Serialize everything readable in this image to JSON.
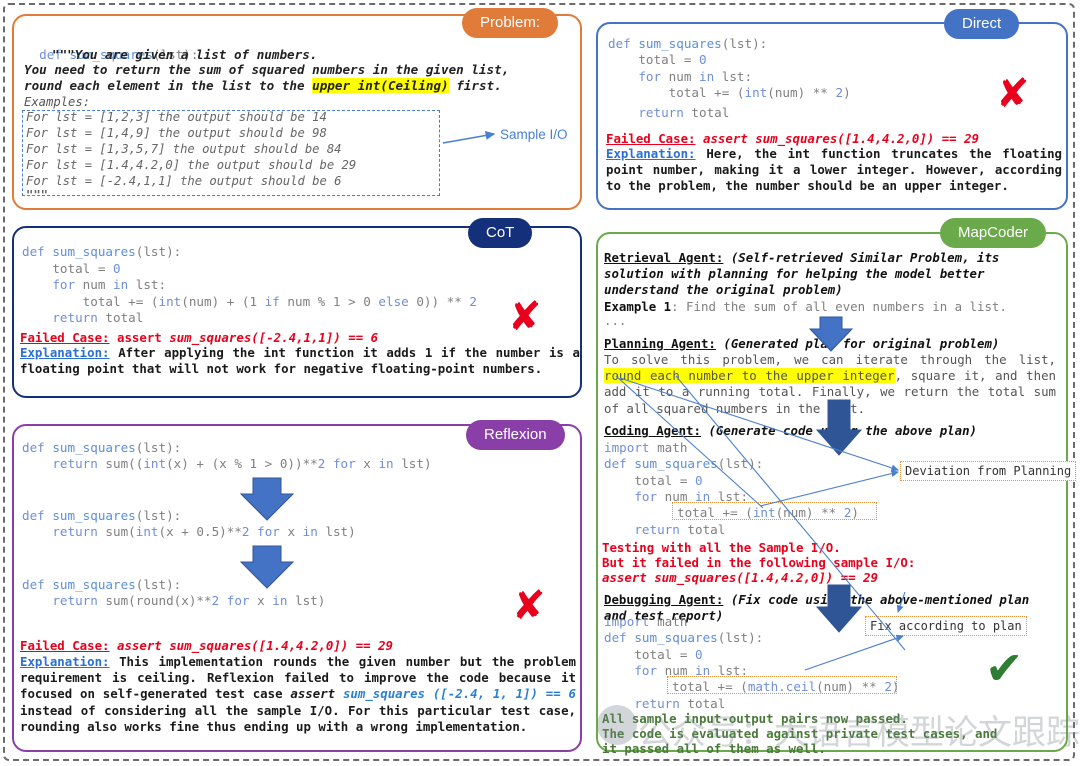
{
  "badges": {
    "problem": {
      "label": "Problem:",
      "color": "#e07b39"
    },
    "direct": {
      "label": "Direct",
      "color": "#4472c4"
    },
    "cot": {
      "label": "CoT",
      "color": "#15307a"
    },
    "reflexion": {
      "label": "Reflexion",
      "color": "#8a3fa8"
    },
    "mapcoder": {
      "label": "MapCoder",
      "color": "#6aaa4a"
    }
  },
  "problem": {
    "signature": "def sum_squares(lst):",
    "doc_lines": [
      "\"\"\"You are given a list of numbers.",
      "You need to return the sum of squared numbers in the given list,",
      "round each element in the list to the ",
      "upper int(Ceiling)",
      " first."
    ],
    "examples_label": "Examples:",
    "examples": [
      "For lst = [1,2,3] the output should be 14",
      "For lst = [1,4,9] the output should be 98",
      "For lst = [1,3,5,7] the output should be 84",
      "For lst = [1.4,4.2,0] the output should be 29",
      "For lst = [-2.4,1,1] the output should be 6"
    ],
    "doc_end": "\"\"\"",
    "annotation": "Sample I/O"
  },
  "direct": {
    "code": [
      "def sum_squares(lst):",
      "    total = 0",
      "    for num in lst:",
      "        total += (int(num) ** 2)",
      "    return total"
    ],
    "failed_label": "Failed Case:",
    "failed_case": "assert sum_squares([1.4,4.2,0]) == 29",
    "explanation_label": "Explanation:",
    "explanation": "Here, the int function truncates the floating point number, making it a lower integer. However, according to the problem, the number should be an upper integer.",
    "verdict": "fail"
  },
  "cot": {
    "code": [
      "def sum_squares(lst):",
      "    total = 0",
      "    for num in lst:",
      "        total += (int(num) + (1 if num % 1 > 0 else 0)) ** 2",
      "    return total"
    ],
    "failed_label": "Failed Case:",
    "failed_case_prefix": "assert ",
    "failed_case": "sum_squares([-2.4,1,1]) == 6",
    "explanation_label": "Explanation:",
    "explanation": "After applying the int function it adds 1 if the number is a floating point that will not work for negative floating-point numbers.",
    "verdict": "fail"
  },
  "reflexion": {
    "attempts": [
      [
        "def sum_squares(lst):",
        "    return sum((int(x) + (x % 1 > 0))**2 for x in lst)"
      ],
      [
        "def sum_squares(lst):",
        "    return sum(int(x + 0.5)**2 for x in lst)"
      ],
      [
        "def sum_squares(lst):",
        "    return sum(round(x)**2 for x in lst)"
      ]
    ],
    "failed_label": "Failed Case:",
    "failed_case": "assert sum_squares([1.4,4.2,0]) == 29",
    "explanation_label": "Explanation:",
    "explanation_part1": "This implementation rounds the given number but the problem requirement is ceiling. Reflexion failed to improve the code because it focused on self-generated test case ",
    "explanation_assert": "assert ",
    "explanation_call": "sum_squares ([-2.4, 1, 1]) == 6",
    "explanation_part2": " instead of considering all the sample I/O. For this particular test case, rounding also works fine thus ending up with a wrong implementation.",
    "verdict": "fail"
  },
  "mapcoder": {
    "retrieval_label": "Retrieval Agent:",
    "retrieval_note": "(Self-retrieved Similar Problem, its solution with planning for helping the model better understand the original problem)",
    "example_label": "Example 1",
    "example_text": ": Find the sum of all even numbers in a list.",
    "ellipsis": "...",
    "planning_label": "Planning Agent:",
    "planning_note": "(Generated plan for original problem)",
    "plan_part1": "To solve this problem, we can iterate through the list, ",
    "plan_highlight": "round each number to the upper integer",
    "plan_part2": ", square it, and then add it to a running total. Finally, we return the total sum of all squared numbers in the list.",
    "coding_label": "Coding Agent:",
    "coding_note": "(Generate code using the above plan)",
    "coding_code": [
      "import math",
      "def sum_squares(lst):",
      "    total = 0",
      "    for num in lst:",
      "        total += (int(num) ** 2)",
      "    return total"
    ],
    "deviation_note": "Deviation from Planning",
    "test_line1": "Testing with all the Sample I/O.",
    "test_line2": "But it failed in the following sample I/O:",
    "test_line3": "assert sum_squares([1.4,4.2,0]) == 29",
    "debug_label": "Debugging Agent:",
    "debug_note": "(Fix code using the above-mentioned plan and test report)",
    "debug_code": [
      "import math",
      "def sum_squares(lst):",
      "    total = 0",
      "    for num in lst:",
      "        total += (math.ceil(num) ** 2)",
      "    return total"
    ],
    "fix_note": "Fix according to plan",
    "passed_lines": [
      "All sample input-output pairs now passed.",
      "The code is evaluated against private test cases, and",
      "it passed all of them as well."
    ],
    "verdict": "pass"
  },
  "watermark": {
    "text": "公众号：大语言模型论文跟踪"
  },
  "icons": {
    "x": "✘",
    "check": "✔",
    "down_arrow": "down-arrow"
  }
}
